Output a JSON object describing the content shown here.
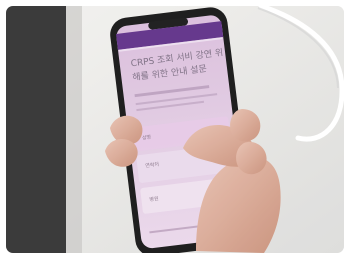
{
  "image": {
    "subject": "hand holding a smartphone displaying a purple Korean survey form",
    "frame_color": "#ececea",
    "screen_color": "#d9b9db",
    "header_color": "#5b2a86",
    "left_panel_color": "#3a3a3a"
  },
  "phone_screen": {
    "title_line_1": "CRPS 조회 서비 강연 위",
    "title_line_2": "해를 위한 안내 설문",
    "field_1_label": "성명",
    "field_2_label": "연락처",
    "field_3_label": "병원"
  }
}
